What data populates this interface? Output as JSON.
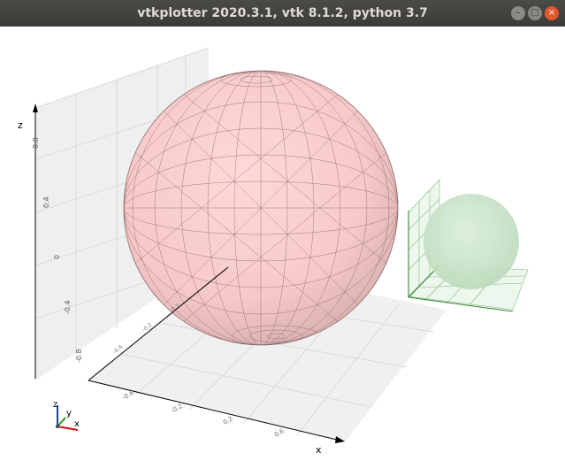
{
  "window": {
    "title": "vtkplotter 2020.3.1, vtk 8.1.2, python 3.7",
    "buttons": {
      "minimize": "–",
      "maximize": "□",
      "close": "×"
    }
  },
  "axes": {
    "z_title": "z",
    "x_title": "x",
    "z_ticks": [
      "0.8",
      "0.4",
      "0",
      "-0.4",
      "-0.8"
    ],
    "x_ticks": [
      "-0.6",
      "-0.2",
      "0.2",
      "0.6"
    ],
    "y_ticks": [
      "0.2",
      "-0.2",
      "-0.6"
    ]
  },
  "orientation_widget": {
    "z": "z",
    "y": "y",
    "x": "x"
  },
  "colors": {
    "big_sphere": "#ffcaca",
    "small_sphere": "#cfe6cf",
    "grid_wall": "#efefef",
    "small_grid": "#2e8b2e"
  }
}
